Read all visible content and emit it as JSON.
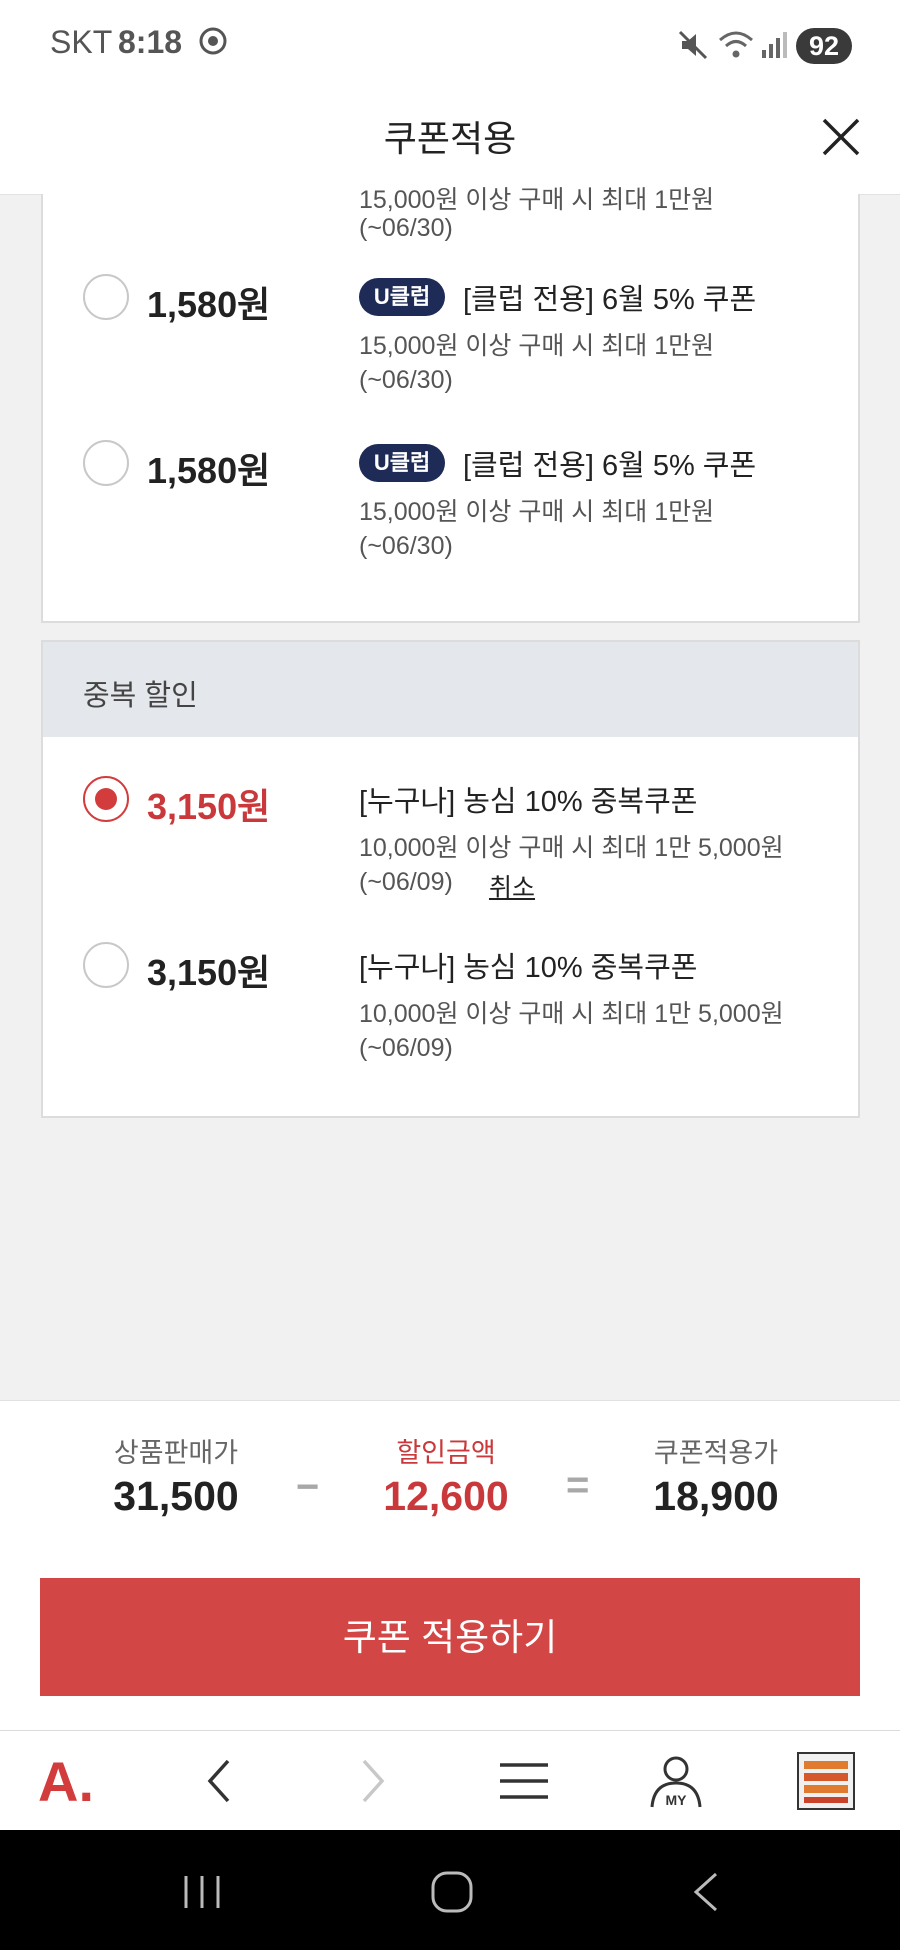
{
  "status_bar": {
    "carrier": "SKT",
    "time": "8:18",
    "battery": "92"
  },
  "header": {
    "title": "쿠폰적용"
  },
  "coupon_section_1": {
    "partial_top": {
      "desc": "15,000원 이상 구매 시 최대 1만원",
      "expiry": "(~06/30)"
    },
    "items": [
      {
        "amount": "1,580원",
        "badge": "U클럽",
        "name": "[클럽 전용] 6월 5% 쿠폰",
        "desc": "15,000원 이상 구매 시 최대 1만원",
        "expiry": "(~06/30)",
        "selected": false
      },
      {
        "amount": "1,580원",
        "badge": "U클럽",
        "name": "[클럽 전용] 6월 5% 쿠폰",
        "desc": "15,000원 이상 구매 시 최대 1만원",
        "expiry": "(~06/30)",
        "selected": false
      }
    ]
  },
  "coupon_section_2": {
    "title": "중복 할인",
    "items": [
      {
        "amount": "3,150원",
        "name": "[누구나] 농심 10% 중복쿠폰",
        "desc": "10,000원 이상 구매 시 최대 1만 5,000원",
        "expiry": "(~06/09)",
        "cancel_label": "취소",
        "selected": true
      },
      {
        "amount": "3,150원",
        "name": "[누구나] 농심 10% 중복쿠폰",
        "desc": "10,000원 이상 구매 시 최대 1만 5,000원",
        "expiry": "(~06/09)",
        "selected": false
      }
    ]
  },
  "summary": {
    "price_label": "상품판매가",
    "price": "31,500",
    "minus": "−",
    "discount_label": "할인금액",
    "discount": "12,600",
    "equals": "=",
    "final_label": "쿠폰적용가",
    "final": "18,900"
  },
  "apply_button": {
    "label": "쿠폰 적용하기"
  },
  "toolbar": {
    "logo": "A.",
    "my_label": "MY"
  },
  "colors": {
    "accent_red": "#d34646",
    "price_red": "#c9393b",
    "badge_navy": "#1d2b56",
    "section_bg": "#e4e7eb"
  }
}
